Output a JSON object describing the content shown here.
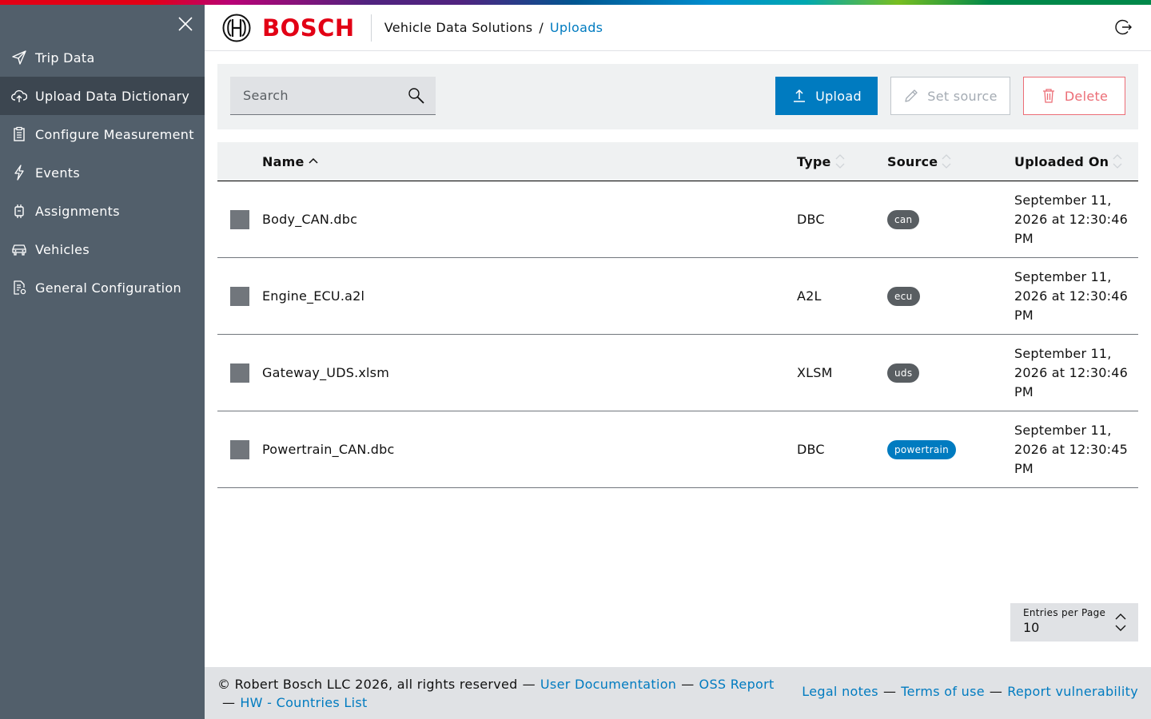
{
  "brand": {
    "logo_text": "BOSCH",
    "colors": {
      "primary": "#007bc0",
      "brand_red": "#e20015",
      "sidebar_bg": "#525f6b",
      "sidebar_active": "#3c4650",
      "danger": "#ec6d76"
    }
  },
  "sidebar": {
    "items": [
      {
        "label": "Trip Data",
        "icon": "send-icon"
      },
      {
        "label": "Upload Data Dictionary",
        "icon": "cloud-upload-icon",
        "active": true
      },
      {
        "label": "Configure Measurement",
        "icon": "clipboard-icon"
      },
      {
        "label": "Events",
        "icon": "lightning-icon"
      },
      {
        "label": "Assignments",
        "icon": "device-icon"
      },
      {
        "label": "Vehicles",
        "icon": "car-icon"
      },
      {
        "label": "General Configuration",
        "icon": "document-settings-icon"
      }
    ]
  },
  "header": {
    "app_name": "Vehicle Data Solutions",
    "separator": "/",
    "current_page": "Uploads"
  },
  "toolbar": {
    "search_placeholder": "Search",
    "upload_label": "Upload",
    "set_source_label": "Set source",
    "delete_label": "Delete"
  },
  "table": {
    "columns": {
      "name": "Name",
      "type": "Type",
      "source": "Source",
      "uploaded_on": "Uploaded On"
    },
    "rows": [
      {
        "name": "Body_CAN.dbc",
        "type": "DBC",
        "source": "can",
        "uploaded_on": "September 11, 2026 at 12:30:46 PM"
      },
      {
        "name": "Engine_ECU.a2l",
        "type": "A2L",
        "source": "ecu",
        "uploaded_on": "September 11, 2026 at 12:30:46 PM"
      },
      {
        "name": "Gateway_UDS.xlsm",
        "type": "XLSM",
        "source": "uds",
        "uploaded_on": "September 11, 2026 at 12:30:46 PM"
      },
      {
        "name": "Powertrain_CAN.dbc",
        "type": "DBC",
        "source": "powertrain",
        "uploaded_on": "September 11, 2026 at 12:30:45 PM"
      }
    ]
  },
  "pagination": {
    "entries_label": "Entries per Page",
    "entries_value": "10"
  },
  "footer": {
    "copyright": "© Robert Bosch LLC 2026, all rights reserved",
    "dash": "—",
    "user_documentation": "User Documentation",
    "oss_report": "OSS Report",
    "hw_countries": "HW - Countries List",
    "legal_notes": "Legal notes",
    "terms_of_use": "Terms of use",
    "report_vulnerability": "Report vulnerability"
  }
}
